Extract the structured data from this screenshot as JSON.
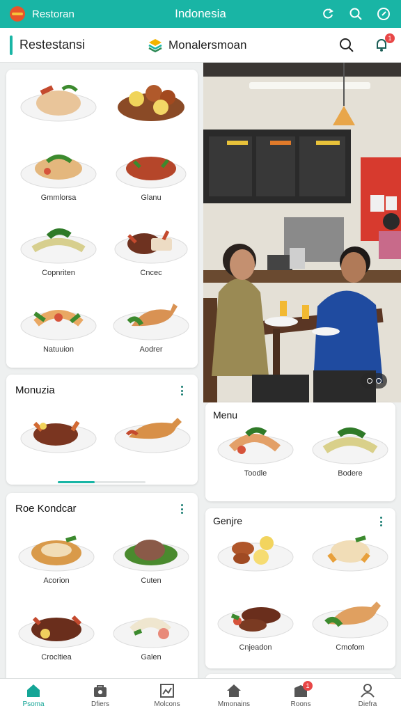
{
  "status_bar": {
    "app_name": "Restoran",
    "center_title": "Indonesia",
    "icons": [
      "restaurant-logo-icon",
      "refresh-icon",
      "search-icon",
      "compass-icon"
    ]
  },
  "top_bar": {
    "title": "Restestansi",
    "center_label": "Monalersmoan",
    "notification_count": "1",
    "icons": [
      "layers-logo-icon",
      "search-icon",
      "bell-icon"
    ]
  },
  "colors": {
    "accent": "#19b5a5",
    "badge": "#e84747",
    "bg": "#eef0f0"
  },
  "grid_card": {
    "dishes": [
      {
        "label": ""
      },
      {
        "label": ""
      },
      {
        "label": "Gmmlorsa"
      },
      {
        "label": "Glanu"
      },
      {
        "label": "Copnriten"
      },
      {
        "label": "Cncec"
      },
      {
        "label": "Natuuion"
      },
      {
        "label": "Aodrer"
      }
    ]
  },
  "monuzia_card": {
    "title": "Monuzia",
    "progress": 0.42
  },
  "roe_card": {
    "title": "Roe Kondcar",
    "dishes": [
      {
        "label": "Acorion"
      },
      {
        "label": "Cuten"
      },
      {
        "label": "Crocltiea"
      },
      {
        "label": "Galen"
      }
    ]
  },
  "menu_card": {
    "title": "Menu",
    "dishes": [
      {
        "label": "Toodle"
      },
      {
        "label": "Bodere"
      }
    ]
  },
  "genjre_card": {
    "title": "Genjre",
    "dishes": [
      {
        "label": ""
      },
      {
        "label": ""
      },
      {
        "label": "Cnjeadon"
      },
      {
        "label": "Cmofom"
      }
    ]
  },
  "bottom_nav": [
    {
      "label": "Psoma",
      "icon": "home-icon",
      "active": true
    },
    {
      "label": "Dfiers",
      "icon": "bag-icon",
      "active": false
    },
    {
      "label": "Molcons",
      "icon": "gallery-icon",
      "active": false
    },
    {
      "label": "Mmonains",
      "icon": "house-icon",
      "active": false
    },
    {
      "label": "Roons",
      "icon": "inbox-icon",
      "active": false,
      "badge": "1"
    },
    {
      "label": "Diefra",
      "icon": "profile-icon",
      "active": false
    }
  ]
}
